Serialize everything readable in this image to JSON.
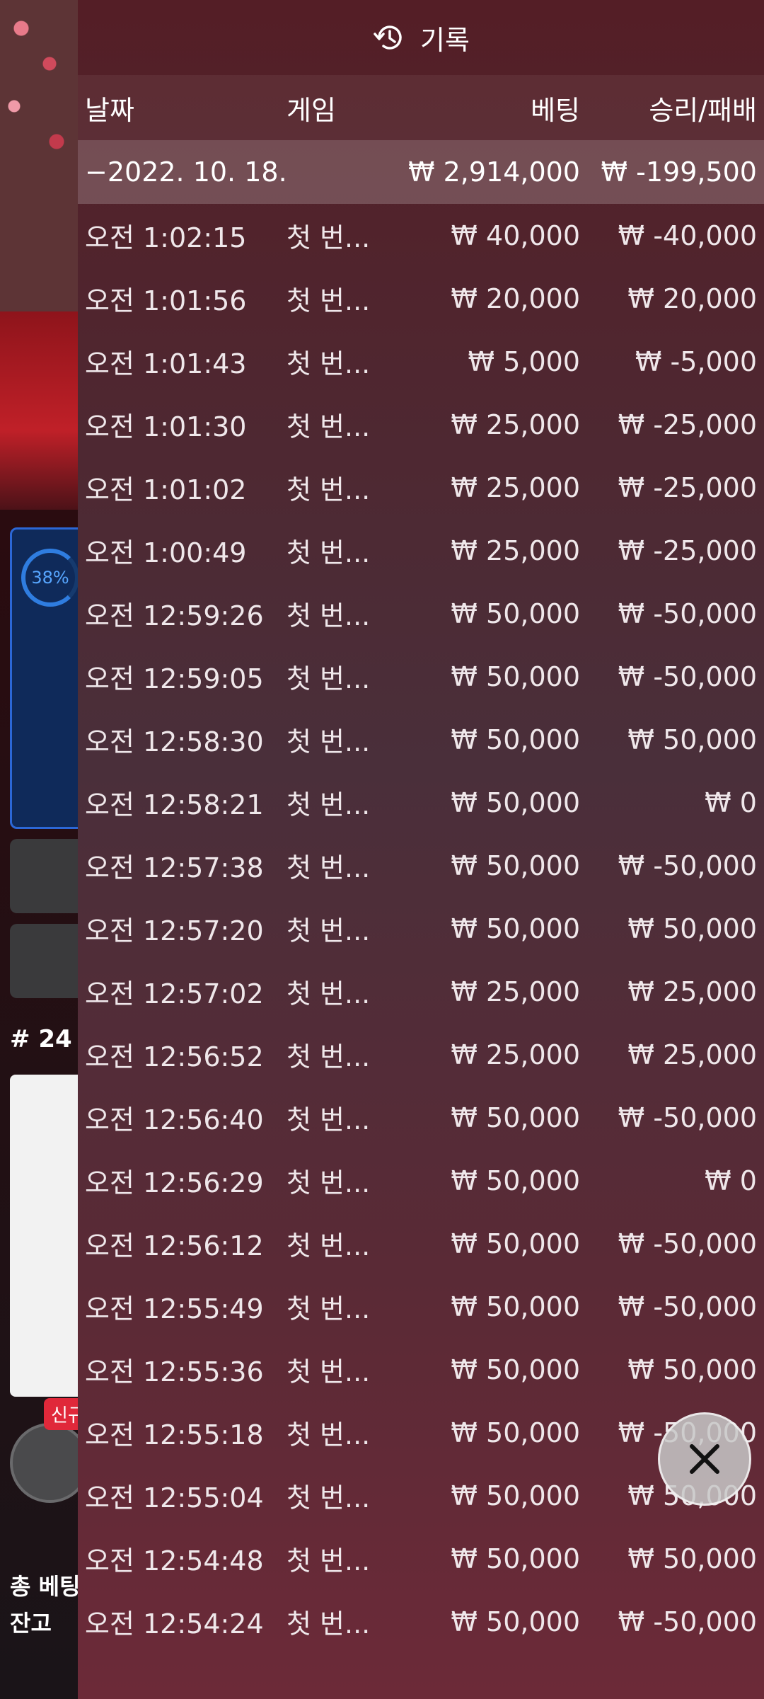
{
  "background": {
    "progress": "38%",
    "round": "# 24",
    "badge_new": "신규",
    "total_bet_label": "총 베팅",
    "balance_label": "잔고"
  },
  "history": {
    "title": "기록",
    "icon": "history-icon",
    "columns": {
      "date": "날짜",
      "game": "게임",
      "bet": "베팅",
      "winloss": "승리/패배"
    },
    "summary": {
      "date": "−2022. 10. 18.",
      "bet": "₩ 2,914,000",
      "winloss": "₩ -199,500"
    },
    "rows": [
      {
        "time": "오전 1:02:15",
        "game": "첫 번...",
        "bet": "₩ 40,000",
        "winloss": "₩ -40,000"
      },
      {
        "time": "오전 1:01:56",
        "game": "첫 번...",
        "bet": "₩ 20,000",
        "winloss": "₩ 20,000"
      },
      {
        "time": "오전 1:01:43",
        "game": "첫 번...",
        "bet": "₩ 5,000",
        "winloss": "₩ -5,000"
      },
      {
        "time": "오전 1:01:30",
        "game": "첫 번...",
        "bet": "₩ 25,000",
        "winloss": "₩ -25,000"
      },
      {
        "time": "오전 1:01:02",
        "game": "첫 번...",
        "bet": "₩ 25,000",
        "winloss": "₩ -25,000"
      },
      {
        "time": "오전 1:00:49",
        "game": "첫 번...",
        "bet": "₩ 25,000",
        "winloss": "₩ -25,000"
      },
      {
        "time": "오전 12:59:26",
        "game": "첫 번...",
        "bet": "₩ 50,000",
        "winloss": "₩ -50,000"
      },
      {
        "time": "오전 12:59:05",
        "game": "첫 번...",
        "bet": "₩ 50,000",
        "winloss": "₩ -50,000"
      },
      {
        "time": "오전 12:58:30",
        "game": "첫 번...",
        "bet": "₩ 50,000",
        "winloss": "₩ 50,000"
      },
      {
        "time": "오전 12:58:21",
        "game": "첫 번...",
        "bet": "₩ 50,000",
        "winloss": "₩ 0"
      },
      {
        "time": "오전 12:57:38",
        "game": "첫 번...",
        "bet": "₩ 50,000",
        "winloss": "₩ -50,000"
      },
      {
        "time": "오전 12:57:20",
        "game": "첫 번...",
        "bet": "₩ 50,000",
        "winloss": "₩ 50,000"
      },
      {
        "time": "오전 12:57:02",
        "game": "첫 번...",
        "bet": "₩ 25,000",
        "winloss": "₩ 25,000"
      },
      {
        "time": "오전 12:56:52",
        "game": "첫 번...",
        "bet": "₩ 25,000",
        "winloss": "₩ 25,000"
      },
      {
        "time": "오전 12:56:40",
        "game": "첫 번...",
        "bet": "₩ 50,000",
        "winloss": "₩ -50,000"
      },
      {
        "time": "오전 12:56:29",
        "game": "첫 번...",
        "bet": "₩ 50,000",
        "winloss": "₩ 0"
      },
      {
        "time": "오전 12:56:12",
        "game": "첫 번...",
        "bet": "₩ 50,000",
        "winloss": "₩ -50,000"
      },
      {
        "time": "오전 12:55:49",
        "game": "첫 번...",
        "bet": "₩ 50,000",
        "winloss": "₩ -50,000"
      },
      {
        "time": "오전 12:55:36",
        "game": "첫 번...",
        "bet": "₩ 50,000",
        "winloss": "₩ 50,000"
      },
      {
        "time": "오전 12:55:18",
        "game": "첫 번...",
        "bet": "₩ 50,000",
        "winloss": "₩ -50,000"
      },
      {
        "time": "오전 12:55:04",
        "game": "첫 번...",
        "bet": "₩ 50,000",
        "winloss": "₩ 50,000"
      },
      {
        "time": "오전 12:54:48",
        "game": "첫 번...",
        "bet": "₩ 50,000",
        "winloss": "₩ 50,000"
      },
      {
        "time": "오전 12:54:24",
        "game": "첫 번...",
        "bet": "₩ 50,000",
        "winloss": "₩ -50,000"
      }
    ]
  },
  "close_icon": "close-icon"
}
